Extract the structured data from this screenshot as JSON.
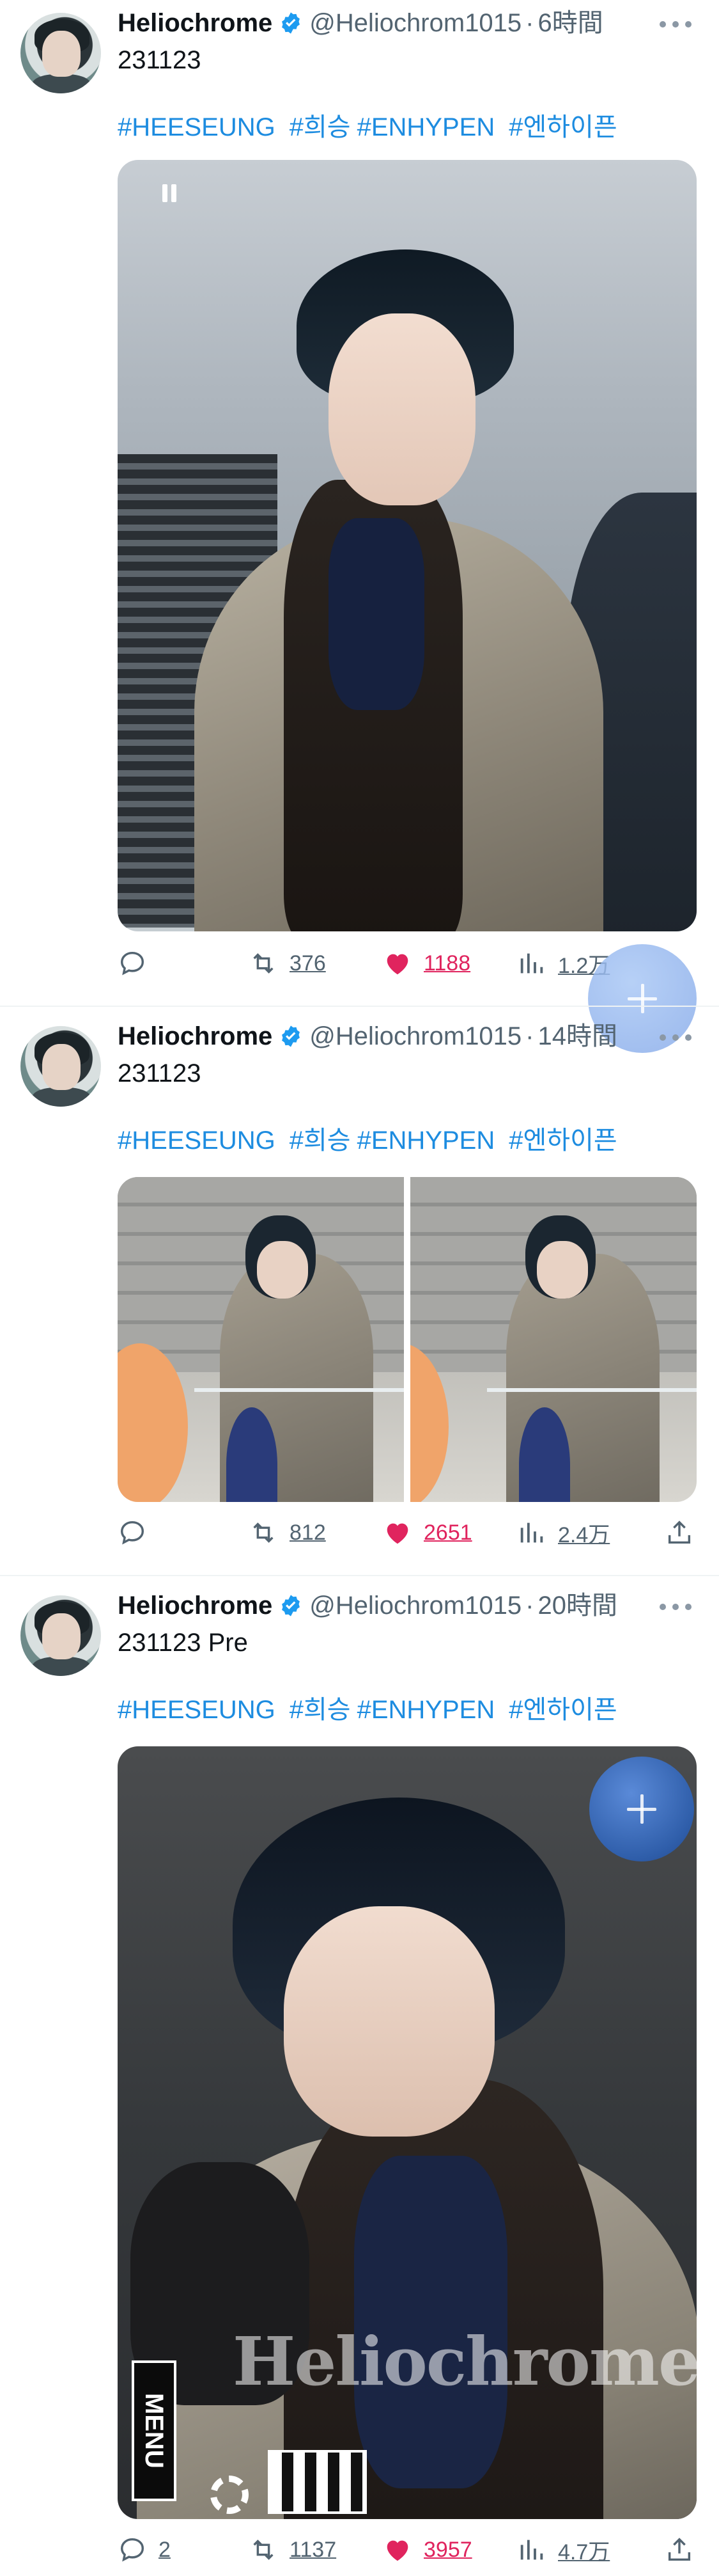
{
  "tweets": [
    {
      "display_name": "Heliochrome",
      "handle": "@Heliochrom1015",
      "separator": "·",
      "time": "6時間",
      "text": "231123",
      "hashtags": [
        "#HEESEUNG",
        "#희승",
        "#ENHYPEN",
        "#엔하이픈"
      ],
      "stats": {
        "replies": "",
        "retweets": "376",
        "likes": "1188",
        "views": "1.2万"
      }
    },
    {
      "display_name": "Heliochrome",
      "handle": "@Heliochrom1015",
      "separator": "·",
      "time": "14時間",
      "text": "231123",
      "hashtags": [
        "#HEESEUNG",
        "#희승",
        "#ENHYPEN",
        "#엔하이픈"
      ],
      "stats": {
        "replies": "",
        "retweets": "812",
        "likes": "2651",
        "views": "2.4万"
      }
    },
    {
      "display_name": "Heliochrome",
      "handle": "@Heliochrom1015",
      "separator": "·",
      "time": "20時間",
      "text": "231123 Pre",
      "hashtags": [
        "#HEESEUNG",
        "#희승",
        "#ENHYPEN",
        "#엔하이픈"
      ],
      "watermark": "Heliochrome",
      "menu_label": "MENU",
      "stats": {
        "replies": "2",
        "retweets": "1137",
        "likes": "3957",
        "views": "4.7万"
      }
    }
  ],
  "colors": {
    "hashtag": "#1d9bf0",
    "verified": "#1d9bf0",
    "like": "#e0245e",
    "muted": "#536471",
    "fab": "#2f5eaa"
  },
  "icons": {
    "reply": "reply-icon",
    "retweet": "retweet-icon",
    "like": "heart-icon",
    "views": "views-icon",
    "share": "share-icon",
    "more": "more-icon",
    "verified": "verified-badge-icon",
    "compose": "plus-icon"
  }
}
